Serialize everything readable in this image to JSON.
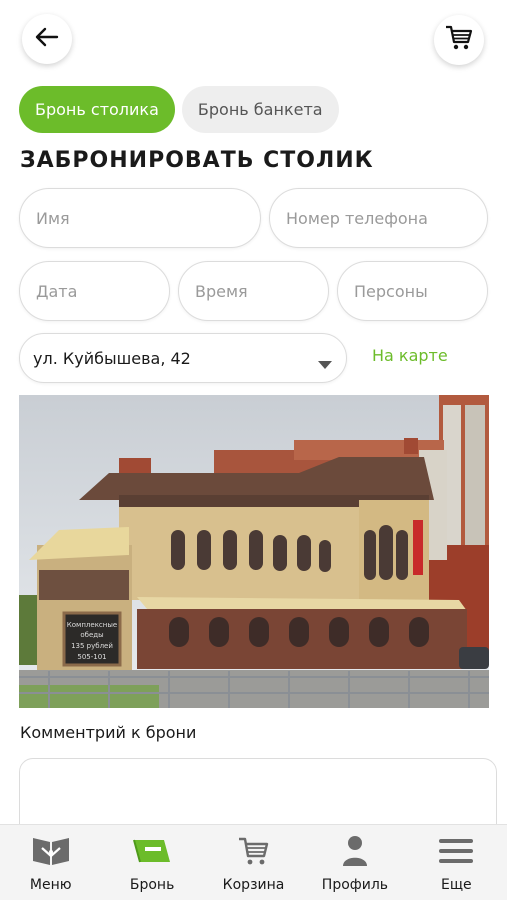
{
  "header": {
    "back_icon": "arrow-left-icon",
    "cart_icon": "cart-icon"
  },
  "tabs": [
    {
      "label": "Бронь столика",
      "active": true
    },
    {
      "label": "Бронь банкета",
      "active": false
    }
  ],
  "form": {
    "title": "ЗАБРОНИРОВАТЬ СТОЛИК",
    "name_placeholder": "Имя",
    "phone_placeholder": "Номер телефона",
    "date_placeholder": "Дата",
    "time_placeholder": "Время",
    "persons_placeholder": "Персоны",
    "address_value": "ул. Куйбышева, 42",
    "map_link": "На карте",
    "comment_label": "Комментрий к брони"
  },
  "photo": {
    "sign_text_1": "Комплексные",
    "sign_text_2": "обеды",
    "sign_price": "135 рублей",
    "sign_phone": "505-101"
  },
  "bottom_nav": [
    {
      "label": "Меню",
      "icon": "menu-book-icon",
      "active": false
    },
    {
      "label": "Бронь",
      "icon": "booking-icon",
      "active": true
    },
    {
      "label": "Корзина",
      "icon": "cart-icon",
      "active": false
    },
    {
      "label": "Профиль",
      "icon": "profile-icon",
      "active": false
    },
    {
      "label": "Еще",
      "icon": "more-icon",
      "active": false
    }
  ],
  "colors": {
    "accent": "#6cbc2a",
    "inactive_tab": "#eeeeee",
    "nav_bg": "#f4f4f4"
  }
}
